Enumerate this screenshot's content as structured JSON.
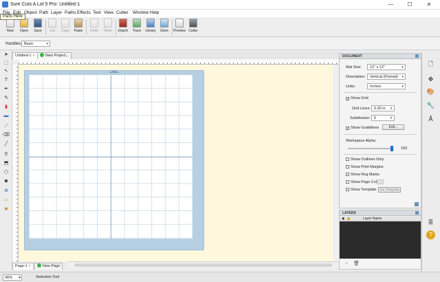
{
  "window": {
    "title": "Sure Cuts A Lot 5 Pro: Untitled-1",
    "minimize": "—",
    "maximize": "☐",
    "close": "✕"
  },
  "tooltip": "Parts Here",
  "menu": [
    "File",
    "Edit",
    "Object",
    "Path",
    "Layer",
    "Paths",
    "Effects",
    "Text",
    "View",
    "Cutter",
    "Window",
    "Help"
  ],
  "toolbar": {
    "new": "New",
    "open": "Open",
    "save": "Save",
    "cut": "Cut",
    "copy": "Copy",
    "paste": "Paste",
    "undo": "Undo",
    "redo": "Redo",
    "import": "Import",
    "trace": "Trace",
    "library": "Library",
    "store": "Store",
    "preview": "Preview",
    "cutter": "Cutter"
  },
  "options": {
    "handles_label": "Handles:",
    "handles_value": "Basic"
  },
  "doc_tabs": {
    "active": "Untitled-1",
    "new": "New Project..."
  },
  "page_tabs": {
    "active": "Page-1",
    "new": "New Page"
  },
  "status": {
    "zoom": "45%",
    "text": "Selection Tool"
  },
  "document_panel": {
    "title": "DOCUMENT",
    "mat_size_label": "Mat Size:",
    "mat_size_value": "12\" x 12\"",
    "orientation_label": "Orientation:",
    "orientation_value": "Vertical (Portrait)",
    "units_label": "Units:",
    "units_value": "Inches",
    "show_grid": "Show Grid",
    "grid_lines_label": "Grid Lines:",
    "grid_lines_value": "6.00 in",
    "subdivision_label": "Subdivision:",
    "subdivision_value": "6",
    "show_guidelines": "Show Guidelines",
    "edit_button": "Edit...",
    "workspace_alpha_label": "Workspace Alpha:",
    "workspace_alpha_value": "100",
    "show_outlines": "Show Outlines Only",
    "show_print_margins": "Show Print Margins",
    "show_reg_marks": "Show Reg Marks",
    "show_page_color": "Show Page Color",
    "show_template": "Show Template",
    "set_template": "Set Template"
  },
  "layers_panel": {
    "title": "LAYERS",
    "col_name": "Layer Name"
  },
  "icons": {
    "check": "✓",
    "arrow": "▾",
    "spin": "⇕",
    "close_tab": "×",
    "add": "+",
    "delete": "🗑"
  }
}
